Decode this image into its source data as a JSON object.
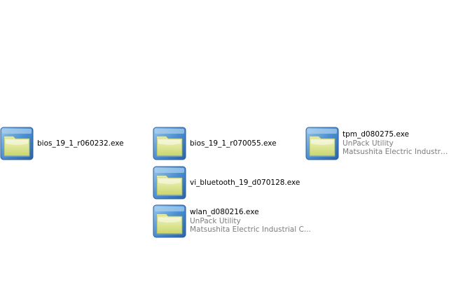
{
  "files": [
    {
      "name": "bios_19_1_r060232.exe",
      "description": "",
      "company": "",
      "icon": "application-folder-icon"
    },
    {
      "name": "bios_19_1_r070055.exe",
      "description": "",
      "company": "",
      "icon": "application-folder-icon"
    },
    {
      "name": "tpm_d080275.exe",
      "description": "UnPack Utility",
      "company": "Matsushita Electric Industrial C...",
      "icon": "application-folder-icon"
    },
    {
      "name": "vi_bluetooth_19_d070128.exe",
      "description": "",
      "company": "",
      "icon": "application-folder-icon"
    },
    {
      "name": "wlan_d080216.exe",
      "description": "UnPack Utility",
      "company": "Matsushita Electric Industrial C...",
      "icon": "application-folder-icon"
    }
  ],
  "colors": {
    "background": "#ffffff",
    "name_text": "#000000",
    "detail_text": "#7d7d7d",
    "icon_frame": "#3f7fc4",
    "icon_fill": "#d6e08a"
  }
}
